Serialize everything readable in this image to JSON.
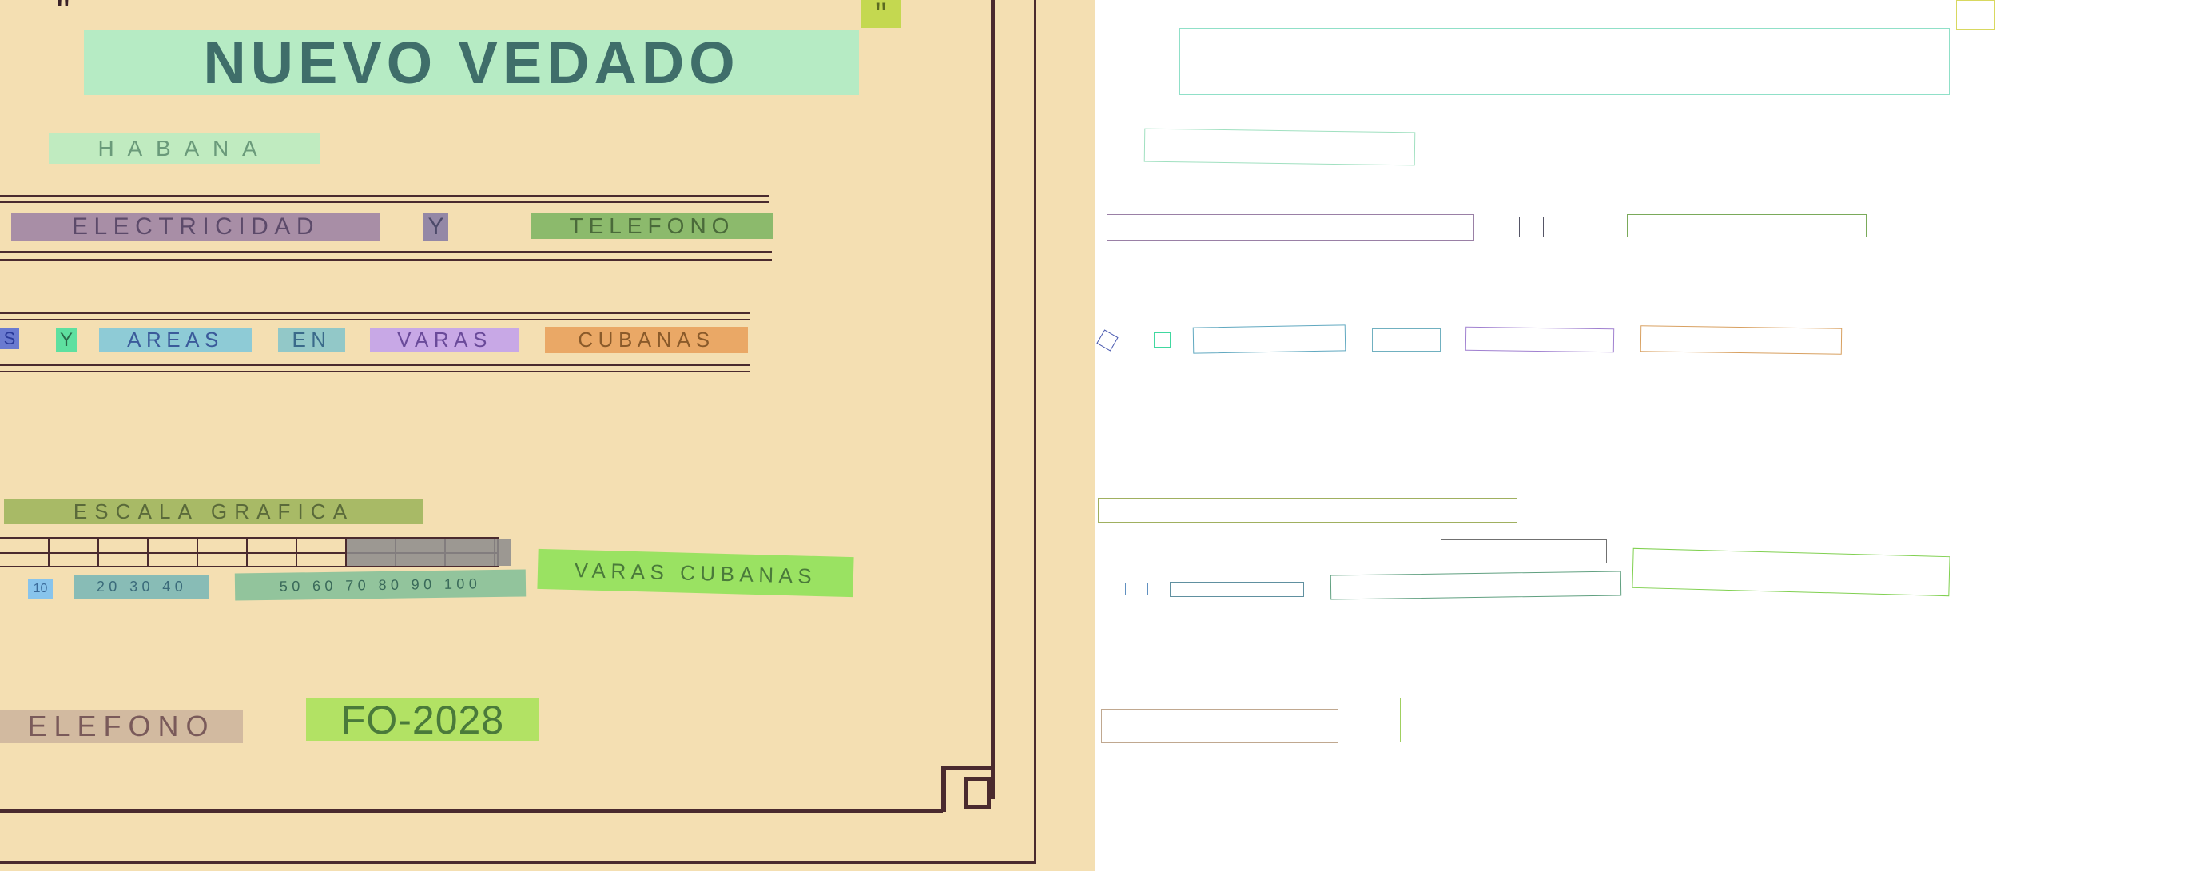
{
  "document": {
    "title_quote_open": "\"",
    "title": "NUEVO VEDADO",
    "title_quote_close": "\"",
    "city": "HABANA",
    "subtitle_words": [
      "ELECTRICIDAD",
      "Y",
      "TELEFONO"
    ],
    "units_words": [
      "S",
      "Y",
      "AREAS",
      "EN",
      "VARAS",
      "CUBANAS"
    ],
    "scale_title": "ESCALA GRAFICA",
    "scale_ticks_a": "10",
    "scale_ticks_b": "20 30 40",
    "scale_ticks_c": "50 60 70 80 90 100",
    "scale_unit": "VARAS CUBANAS",
    "phone_label": "ELEFONO",
    "phone_number": "FO-2028"
  }
}
